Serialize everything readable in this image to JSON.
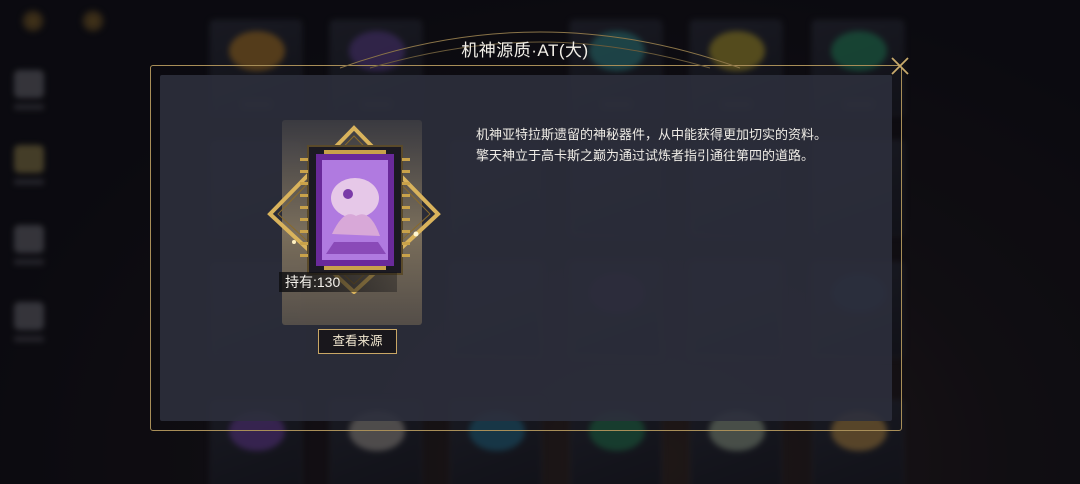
{
  "dialog": {
    "title": "机神源质·AT(大)",
    "owned_label": "持有:130",
    "source_button_label": "查看来源",
    "description": "机神亚特拉斯遗留的神秘器件，从中能获得更加切实的资料。擎天神立于高卡斯之巅为通过试炼者指引通往第四的道路。",
    "close_icon": "close-x-icon"
  },
  "background": {
    "nav_icons": [
      "book-icon",
      "crossed-swords-icon",
      "chest-icon",
      "cloud-icon"
    ],
    "gem_colors": [
      "#c88a2a",
      "#6a4aa0",
      "#3a9a9a",
      "#c8b030",
      "#2a9a6a",
      "#b8b2a8",
      "#d0a050"
    ]
  },
  "colors": {
    "frame_gold": "#a88e58",
    "panel": "#2c2f3c",
    "item_purple": "#9a5ad8",
    "diamond_gold": "#d9b35c"
  }
}
